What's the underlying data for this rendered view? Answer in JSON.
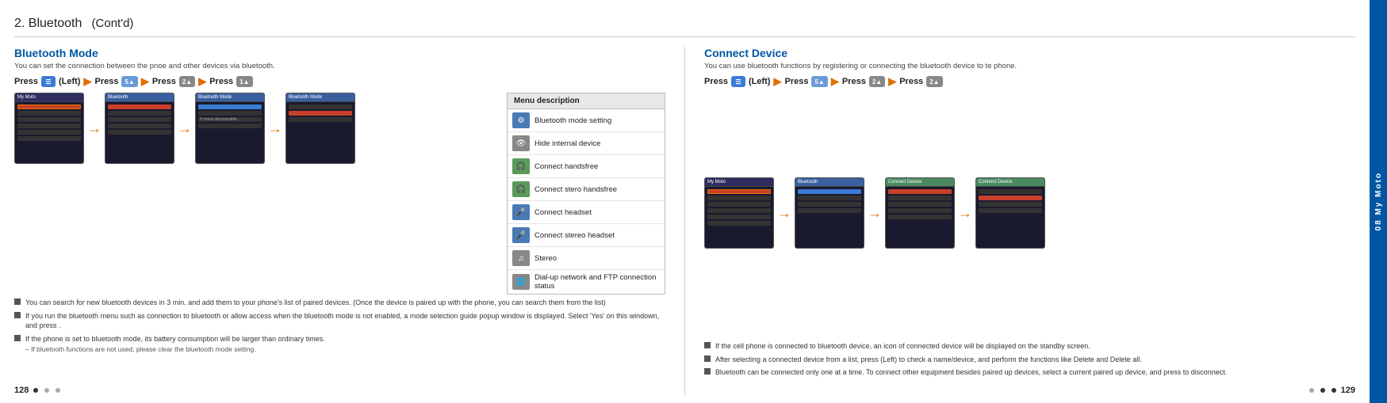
{
  "page": {
    "title": "2. Bluetooth",
    "title_cont": "(Cont'd)"
  },
  "bluetooth_mode": {
    "section_title": "Bluetooth Mode",
    "subtitle": "You can set the connection between the pnoe and other devices via bluetooth.",
    "press_sequence": "Press  (Left) ▶Press  ▶Press  ▶Press ",
    "press_label": "Press",
    "left_label": "(Left)",
    "menu_description_title": "Menu description",
    "menu_items": [
      {
        "label": "Bluetooth mode setting"
      },
      {
        "label": "Hide internal device"
      },
      {
        "label": "Connect handsfree"
      },
      {
        "label": "Connect stero handsfree"
      },
      {
        "label": "Connect headset"
      },
      {
        "label": "Connect stereo headset"
      },
      {
        "label": "Stereo"
      },
      {
        "label": "Dial-up network and FTP connection status"
      }
    ],
    "notes": [
      "You can search for new bluetooth devices in 3 min. and add them to your phone's list of paired devices. (Once the device is paired up with the phone, you can search them from the list)",
      "If you run the bluetooth menu such as connection to bluetooth or allow access when the bluetooth mode is not enabled, a mode selection guide popup window is displayed. Select 'Yes' on this windown, and press  .",
      "If the phone is set to bluetooth mode, its battery consumption will be larger than ordinary times.",
      "– If bluetooth functions are not used, please clear the bluetooth mode setting."
    ]
  },
  "connect_device": {
    "section_title": "Connect Device",
    "subtitle": "You can use bluetooth functions by registering or connecting the bluetooth device to te phone.",
    "press_label": "Press",
    "left_label": "(Left)",
    "notes": [
      "If the cell phone is connected to bluetooth device, an icon of connected device will be displayed on the standby screen.",
      "After selecting a connected device from a list, press  (Left) to check a name/device, and perform the functions like Delete and Delete all.",
      "Bluetooth can be connected only one at a time. To connect other equipment besides paired up devices, select a current paired up device, and press  to disconnect."
    ]
  },
  "page_numbers": {
    "left": "128",
    "right": "129"
  },
  "sidebar": {
    "label": "08 My Moto"
  }
}
